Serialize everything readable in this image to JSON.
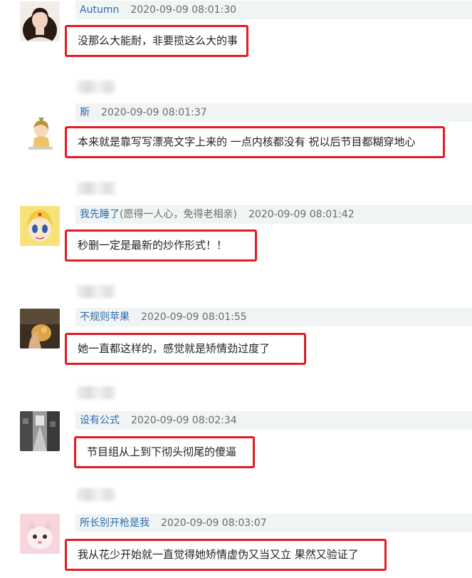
{
  "comments": [
    {
      "username": "Autumn",
      "user_note": "",
      "timestamp": "2020-09-09 08:01:30",
      "content": "没那么大能耐，非要揽这么大的事",
      "avatar_icon": "avatar-woman-portrait"
    },
    {
      "username": "斯",
      "user_note": "",
      "timestamp": "2020-09-09 08:01:37",
      "content": "本来就是靠写写漂亮文字上来的 一点内核都没有 祝以后节目都糊穿地心",
      "avatar_icon": "avatar-cartoon-girl"
    },
    {
      "username": "我先睡了",
      "user_note": "(愿得一人心，免得老相亲)",
      "timestamp": "2020-09-09 08:01:42",
      "content": "秒删一定是最新的炒作形式！！",
      "avatar_icon": "avatar-anime-sailor"
    },
    {
      "username": "不规则苹果",
      "user_note": "",
      "timestamp": "2020-09-09 08:01:55",
      "content": "她一直都这样的，感觉就是矫情劲过度了",
      "avatar_icon": "avatar-hand-apple"
    },
    {
      "username": "设有公式",
      "user_note": "",
      "timestamp": "2020-09-09 08:02:34",
      "content": "节目组从上到下彻头彻尾的傻逼",
      "avatar_icon": "avatar-street-photo"
    },
    {
      "username": "所长别开枪是我",
      "user_note": "",
      "timestamp": "2020-09-09 08:03:07",
      "content": "我从花少开始就一直觉得她矫情虚伪又当又立 果然又验证了",
      "avatar_icon": "avatar-pink-cat"
    }
  ]
}
